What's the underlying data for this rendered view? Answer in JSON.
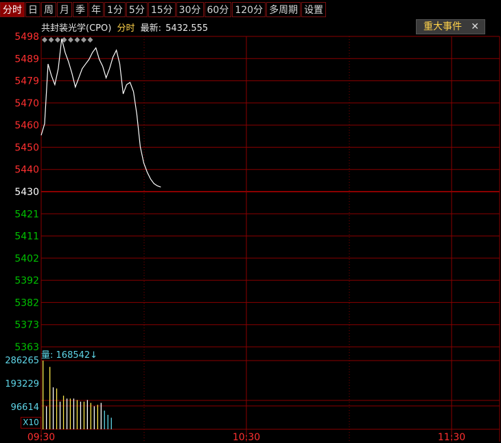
{
  "tabs": [
    {
      "label": "分时",
      "active": true
    },
    {
      "label": "日"
    },
    {
      "label": "周"
    },
    {
      "label": "月"
    },
    {
      "label": "季"
    },
    {
      "label": "年"
    },
    {
      "label": "1分"
    },
    {
      "label": "5分"
    },
    {
      "label": "15分"
    },
    {
      "label": "30分"
    },
    {
      "label": "60分"
    },
    {
      "label": "120分"
    },
    {
      "label": "多周期"
    },
    {
      "label": "设置"
    }
  ],
  "header": {
    "stock_name": "共封装光学(CPO)",
    "mode": "分时",
    "latest_label": "最新:",
    "latest_value": "5432.555"
  },
  "events_button": {
    "label": "重大事件",
    "close": "✕"
  },
  "volume": {
    "label": "量:",
    "value": "168542",
    "arrow": "↓",
    "scale_button": "X10"
  },
  "colors": {
    "up": "#ff3030",
    "down": "#00c000",
    "ref": "#ffffff",
    "grid": "#8b0000",
    "price_line": "#ffffff",
    "volume_axis": "#5fd6e8"
  },
  "chart_data": {
    "type": "line",
    "ref_price": 5430,
    "price_axis_labels": [
      "5498",
      "5489",
      "5479",
      "5470",
      "5460",
      "5450",
      "5440",
      "5430",
      "5421",
      "5411",
      "5402",
      "5392",
      "5382",
      "5373",
      "5363"
    ],
    "volume_axis_labels": [
      "286265",
      "193229",
      "96614"
    ],
    "time_labels": [
      "09:30",
      "10:30",
      "11:30"
    ],
    "x_minutes": [
      0,
      1,
      2,
      3,
      4,
      5,
      6,
      7,
      8,
      9,
      10,
      11,
      12,
      13,
      14,
      15,
      16,
      17,
      18,
      19,
      20,
      21,
      22,
      23,
      24,
      25,
      26,
      27,
      28,
      29,
      30,
      31,
      32,
      33,
      34,
      35
    ],
    "price": [
      5455,
      5460,
      5486,
      5481,
      5477,
      5484,
      5497,
      5491,
      5487,
      5482,
      5476,
      5480,
      5484,
      5486,
      5488,
      5491,
      5493,
      5488,
      5485,
      5480,
      5484,
      5489,
      5492,
      5486,
      5473,
      5477,
      5478,
      5474,
      5464,
      5450,
      5443,
      5439,
      5436,
      5434,
      5433,
      5432.5
    ],
    "volume": [
      286265,
      96000,
      260000,
      175000,
      170000,
      115000,
      140000,
      128000,
      128000,
      128000,
      122000,
      115000,
      115000,
      122000,
      110000,
      96000,
      102000,
      110000,
      78000,
      60000,
      48000
    ],
    "volume_max": 286265
  }
}
